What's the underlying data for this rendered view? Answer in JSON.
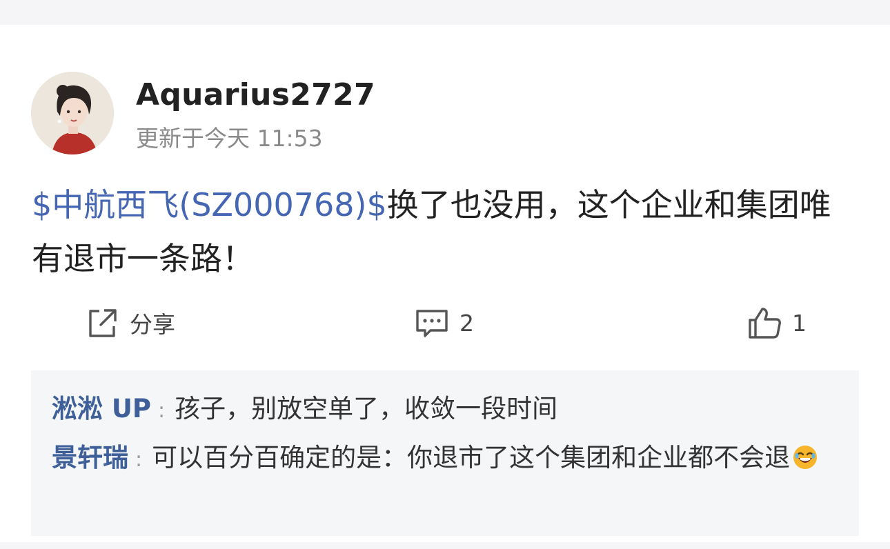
{
  "post": {
    "author": "Aquarius2727",
    "timestamp": "更新于今天 11:53",
    "stock_tag": "$中航西飞(SZ000768)$",
    "text": "换了也没用，这个企业和集团唯有退市一条路！"
  },
  "actions": {
    "share_label": "分享",
    "comment_count": "2",
    "like_count": "1"
  },
  "comments": [
    {
      "author": "淞淞 UP",
      "separator": ":",
      "text": "孩子，别放空单了，收敛一段时间"
    },
    {
      "author": "景轩瑞",
      "separator": ":",
      "text": "可以百分百确定的是：你退市了这个集团和企业都不会退",
      "emoji": "laughing-emoji"
    }
  ],
  "colors": {
    "stock_link": "#4566b3",
    "comment_author": "#3e5f98",
    "comment_bg": "#f5f6f8"
  }
}
